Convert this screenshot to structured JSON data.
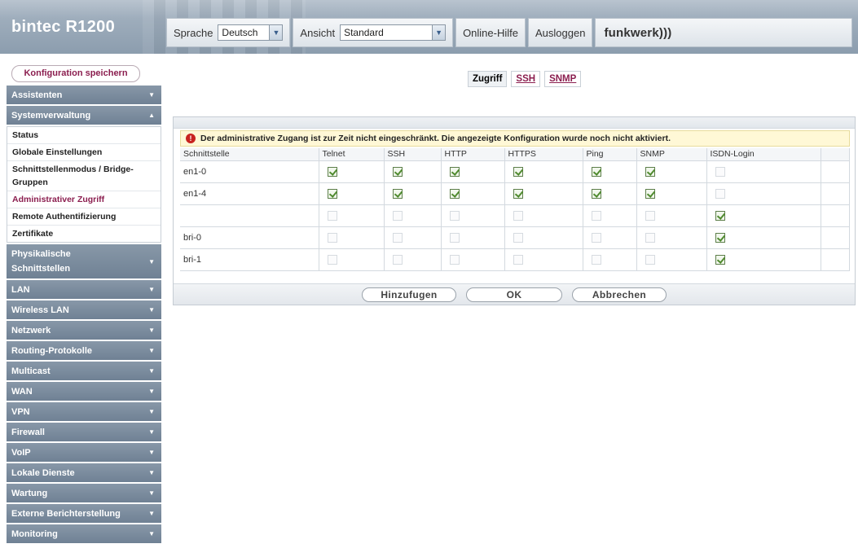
{
  "header": {
    "brand": "bintec R1200",
    "language_label": "Sprache",
    "language_value": "Deutsch",
    "view_label": "Ansicht",
    "view_value": "Standard",
    "help": "Online-Hilfe",
    "logout": "Ausloggen",
    "logo_text": "funkwerk",
    "logo_mark": ")))"
  },
  "sidebar": {
    "save_button": "Konfiguration speichern",
    "items": [
      {
        "label": "Assistenten"
      },
      {
        "label": "Systemverwaltung",
        "expanded": true
      },
      {
        "label": "Physikalische Schnittstellen"
      },
      {
        "label": "LAN"
      },
      {
        "label": "Wireless LAN"
      },
      {
        "label": "Netzwerk"
      },
      {
        "label": "Routing-Protokolle"
      },
      {
        "label": "Multicast"
      },
      {
        "label": "WAN"
      },
      {
        "label": "VPN"
      },
      {
        "label": "Firewall"
      },
      {
        "label": "VoIP"
      },
      {
        "label": "Lokale Dienste"
      },
      {
        "label": "Wartung"
      },
      {
        "label": "Externe Berichterstellung"
      },
      {
        "label": "Monitoring"
      }
    ],
    "sub_items": [
      {
        "label": "Status"
      },
      {
        "label": "Globale Einstellungen"
      },
      {
        "label": "Schnittstellenmodus / Bridge-Gruppen"
      },
      {
        "label": "Administrativer Zugriff",
        "active": true
      },
      {
        "label": "Remote Authentifizierung"
      },
      {
        "label": "Zertifikate"
      }
    ]
  },
  "tabs": [
    {
      "label": "Zugriff",
      "active": true
    },
    {
      "label": "SSH",
      "active": false
    },
    {
      "label": "SNMP",
      "active": false
    }
  ],
  "notice": "Der administrative Zugang ist zur Zeit nicht eingeschränkt. Die angezeigte Konfiguration wurde noch nicht aktiviert.",
  "table": {
    "headers": [
      "Schnittstelle",
      "Telnet",
      "SSH",
      "HTTP",
      "HTTPS",
      "Ping",
      "SNMP",
      "ISDN-Login"
    ],
    "rows": [
      {
        "iface": "en1-0",
        "checks": [
          true,
          true,
          true,
          true,
          true,
          true,
          false
        ]
      },
      {
        "iface": "en1-4",
        "checks": [
          true,
          true,
          true,
          true,
          true,
          true,
          false
        ]
      },
      {
        "iface": "",
        "checks": [
          false,
          false,
          false,
          false,
          false,
          false,
          true
        ]
      },
      {
        "iface": "bri-0",
        "checks": [
          false,
          false,
          false,
          false,
          false,
          false,
          true
        ]
      },
      {
        "iface": "bri-1",
        "checks": [
          false,
          false,
          false,
          false,
          false,
          false,
          true
        ]
      }
    ]
  },
  "buttons": {
    "add": "Hinzufugen",
    "ok": "OK",
    "cancel": "Abbrechen"
  },
  "colors": {
    "nav_bg": "#7a8b9d",
    "accent": "#8b1e4f",
    "notice_bg": "#fff8d6",
    "check": "#4f8a2e"
  }
}
